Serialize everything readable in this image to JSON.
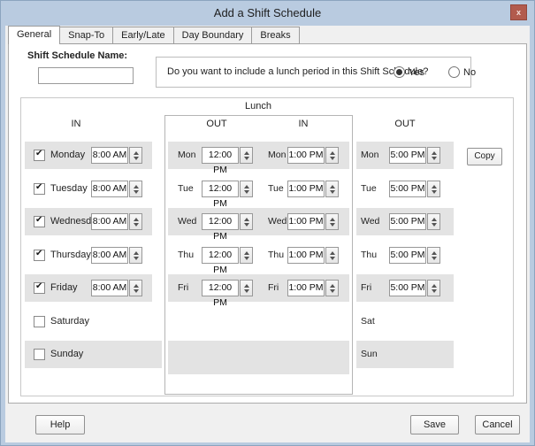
{
  "window": {
    "title": "Add a Shift Schedule",
    "close_glyph": "x"
  },
  "tabs": [
    {
      "label": "General"
    },
    {
      "label": "Snap-To"
    },
    {
      "label": "Early/Late"
    },
    {
      "label": "Day Boundary"
    },
    {
      "label": "Breaks"
    }
  ],
  "form": {
    "name_label": "Shift Schedule Name:",
    "name_value": "",
    "lunch_question": "Do you want to include a lunch period in this Shift Schedule?",
    "yes_label": "Yes",
    "no_label": "No",
    "lunch_selected": "Yes"
  },
  "grid": {
    "lunch_header": "Lunch",
    "headers": {
      "in": "IN",
      "lunch_out": "OUT",
      "lunch_in": "IN",
      "out": "OUT"
    },
    "copy_label": "Copy",
    "rows": [
      {
        "day": "Monday",
        "abbr": "Mon",
        "checked": true,
        "in": "8:00 AM",
        "lunch_out": "12:00 PM",
        "lunch_in": "1:00 PM",
        "out": "5:00 PM"
      },
      {
        "day": "Tuesday",
        "abbr": "Tue",
        "checked": true,
        "in": "8:00 AM",
        "lunch_out": "12:00 PM",
        "lunch_in": "1:00 PM",
        "out": "5:00 PM"
      },
      {
        "day": "Wednesday",
        "abbr": "Wed",
        "checked": true,
        "in": "8:00 AM",
        "lunch_out": "12:00 PM",
        "lunch_in": "1:00 PM",
        "out": "5:00 PM"
      },
      {
        "day": "Thursday",
        "abbr": "Thu",
        "checked": true,
        "in": "8:00 AM",
        "lunch_out": "12:00 PM",
        "lunch_in": "1:00 PM",
        "out": "5:00 PM"
      },
      {
        "day": "Friday",
        "abbr": "Fri",
        "checked": true,
        "in": "8:00 AM",
        "lunch_out": "12:00 PM",
        "lunch_in": "1:00 PM",
        "out": "5:00 PM"
      },
      {
        "day": "Saturday",
        "abbr": "Sat",
        "checked": false
      },
      {
        "day": "Sunday",
        "abbr": "Sun",
        "checked": false
      }
    ]
  },
  "footer": {
    "help_label": "Help",
    "save_label": "Save",
    "cancel_label": "Cancel"
  },
  "colors": {
    "titlebar": "#b9cbe0",
    "row_band": "#e3e3e3",
    "close_button": "#b25b4d",
    "footer_bg": "#f0f0f0"
  }
}
